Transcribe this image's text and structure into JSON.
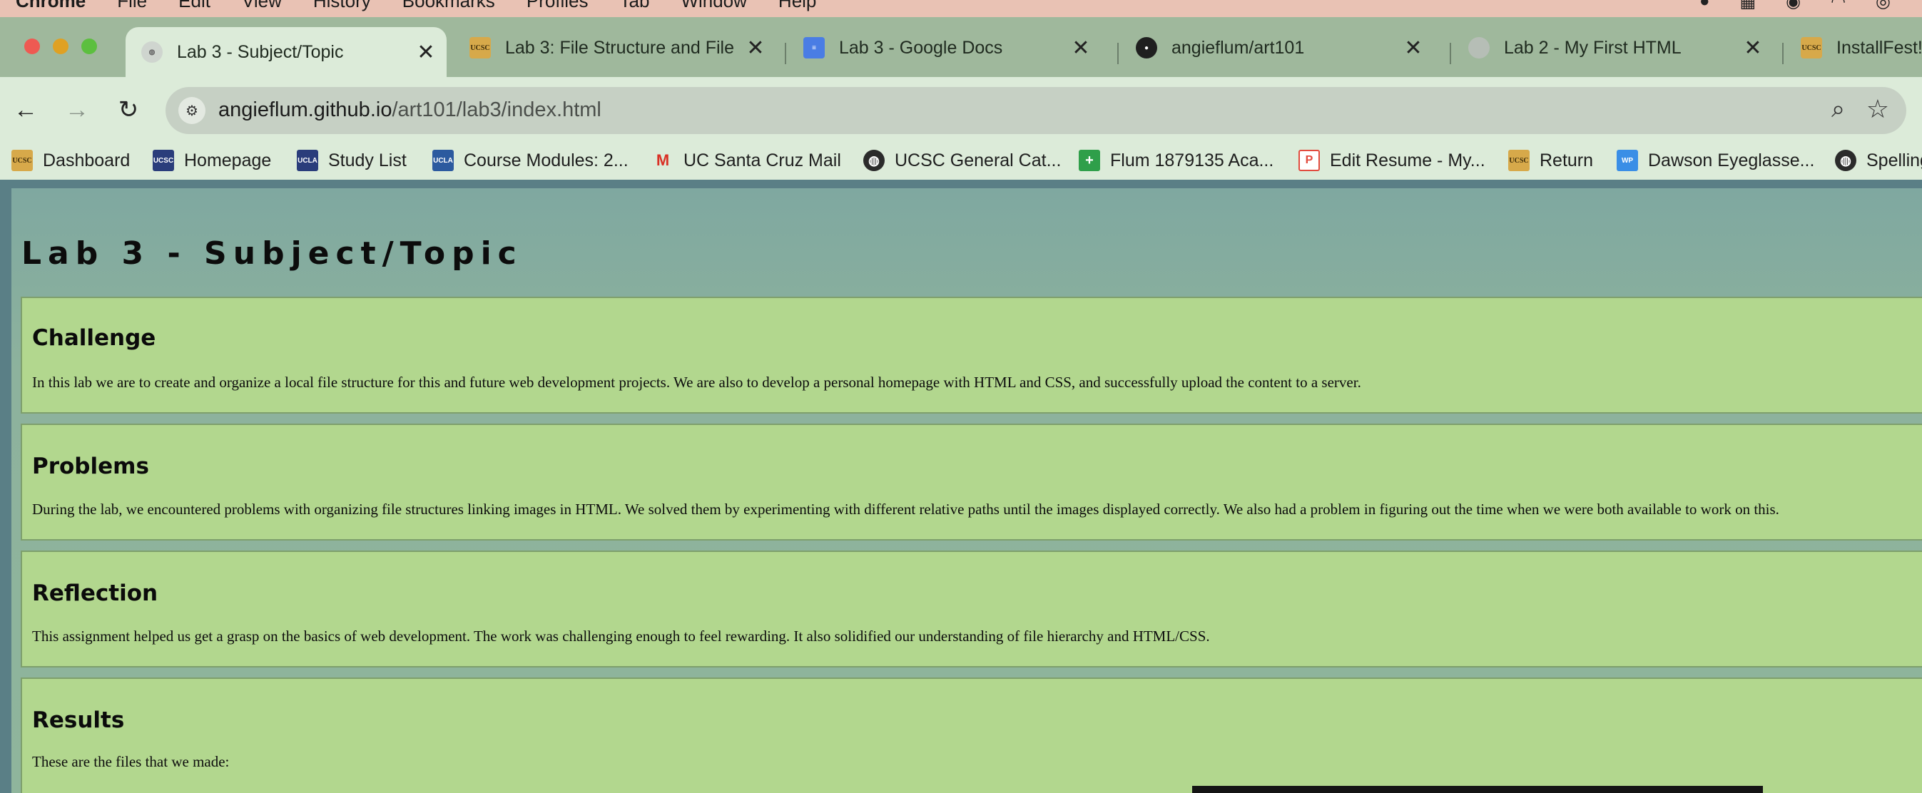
{
  "menubar": {
    "app": "Chrome",
    "items": [
      "File",
      "Edit",
      "View",
      "History",
      "Bookmarks",
      "Profiles",
      "Tab",
      "Window",
      "Help"
    ]
  },
  "tabs": [
    {
      "title": "Lab 3 - Subject/Topic",
      "icon": "globe-icon",
      "active": true
    },
    {
      "title": "Lab 3: File Structure and File",
      "icon": "ucsc-icon",
      "active": false
    },
    {
      "title": "Lab 3 - Google Docs",
      "icon": "google-docs-icon",
      "active": false
    },
    {
      "title": "angieflum/art101",
      "icon": "github-icon",
      "active": false
    },
    {
      "title": "Lab 2 - My First HTML",
      "icon": "globe-icon",
      "active": false
    },
    {
      "title": "InstallFest!",
      "icon": "ucsc-icon",
      "active": false
    }
  ],
  "omnibox": {
    "host": "angieflum.github.io",
    "path": "/art101/lab3/index.html"
  },
  "bookmarks": [
    {
      "label": "Dashboard",
      "icon": "UCSC"
    },
    {
      "label": "Homepage",
      "icon": "UCSC"
    },
    {
      "label": "Study List",
      "icon": "UCLA"
    },
    {
      "label": "Course Modules: 2...",
      "icon": "UCLA"
    },
    {
      "label": "UC Santa Cruz Mail",
      "icon": "M"
    },
    {
      "label": "UCSC General Cat...",
      "icon": "globe"
    },
    {
      "label": "Flum 1879135 Aca...",
      "icon": "+"
    },
    {
      "label": "Edit Resume - My...",
      "icon": "P"
    },
    {
      "label": "Return",
      "icon": "UCSC"
    },
    {
      "label": "Dawson Eyeglasse...",
      "icon": "WP"
    },
    {
      "label": "Spelling",
      "icon": "globe"
    }
  ],
  "page": {
    "title": "Lab 3 - Subject/Topic",
    "sections": [
      {
        "heading": "Challenge",
        "text": "In this lab we are to create and organize a local file structure for this and future web development projects. We are also to develop a personal homepage with HTML and CSS, and successfully upload the content to a server."
      },
      {
        "heading": "Problems",
        "text": "During the lab, we encountered problems with organizing file structures linking images in HTML. We solved them by experimenting with different relative paths until the images displayed correctly. We also had a problem in figuring out the time when we were both available to work on this."
      },
      {
        "heading": "Reflection",
        "text": "This assignment helped us get a grasp on the basics of web development. The work was challenging enough to feel rewarding. It also solidified our understanding of file hierarchy and HTML/CSS."
      },
      {
        "heading": "Results",
        "text": "These are the files that we made:"
      }
    ]
  }
}
